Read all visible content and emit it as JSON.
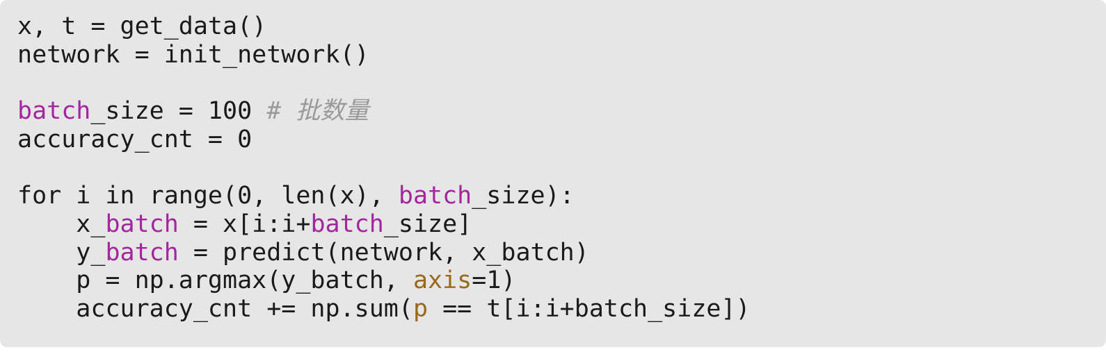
{
  "code": {
    "lines": [
      [
        {
          "text": "x, t = get_data()",
          "style": "plain"
        }
      ],
      [
        {
          "text": "network = init_network()",
          "style": "plain"
        }
      ],
      [],
      [
        {
          "text": "batch",
          "style": "purple"
        },
        {
          "text": "_size = 100 ",
          "style": "plain"
        },
        {
          "text": "# 批数量",
          "style": "comment"
        }
      ],
      [
        {
          "text": "accuracy_cnt = 0",
          "style": "plain"
        }
      ],
      [],
      [
        {
          "text": "for i in range(0, len(x), ",
          "style": "plain"
        },
        {
          "text": "batch",
          "style": "purple"
        },
        {
          "text": "_size):",
          "style": "plain"
        }
      ],
      [
        {
          "text": "    x_",
          "style": "plain"
        },
        {
          "text": "batch",
          "style": "purple"
        },
        {
          "text": " = x[i:i+",
          "style": "plain"
        },
        {
          "text": "batch",
          "style": "purple"
        },
        {
          "text": "_size]",
          "style": "plain"
        }
      ],
      [
        {
          "text": "    y_",
          "style": "plain"
        },
        {
          "text": "batch",
          "style": "purple"
        },
        {
          "text": " = predict(network, x_batch)",
          "style": "plain"
        }
      ],
      [
        {
          "text": "    p = np.argmax(y_batch, ",
          "style": "plain"
        },
        {
          "text": "axis",
          "style": "gold"
        },
        {
          "text": "=1)",
          "style": "plain"
        }
      ],
      [
        {
          "text": "    accuracy_cnt += np.sum(",
          "style": "plain"
        },
        {
          "text": "p",
          "style": "gold"
        },
        {
          "text": " == t[i:i+batch_size])",
          "style": "plain"
        }
      ]
    ]
  }
}
